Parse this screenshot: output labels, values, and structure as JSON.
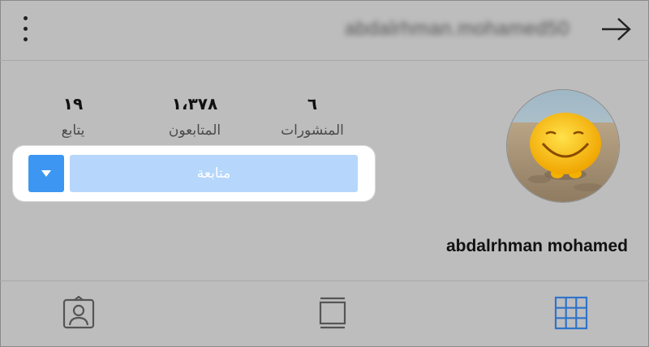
{
  "header": {
    "username": "abdalrhman.mohamed50",
    "menu_icon": "kebab-menu-icon",
    "back_icon": "arrow-right-icon"
  },
  "profile": {
    "display_name": "abdalrhman mohamed",
    "stats": {
      "posts": {
        "value": "٦",
        "label": "المنشورات"
      },
      "followers": {
        "value": "١،٣٧٨",
        "label": "المتابعون"
      },
      "following": {
        "value": "١٩",
        "label": "يتابع"
      }
    },
    "follow_button_label": "متابعة",
    "dropdown_icon": "caret-down-icon"
  },
  "tabs": [
    {
      "icon": "tagged-person-icon"
    },
    {
      "icon": "feed-list-icon"
    },
    {
      "icon": "grid-icon",
      "active": true
    }
  ],
  "colors": {
    "background": "#bdbdbd",
    "accent": "#3d97f2",
    "follow_button": "#b6d7fb"
  }
}
